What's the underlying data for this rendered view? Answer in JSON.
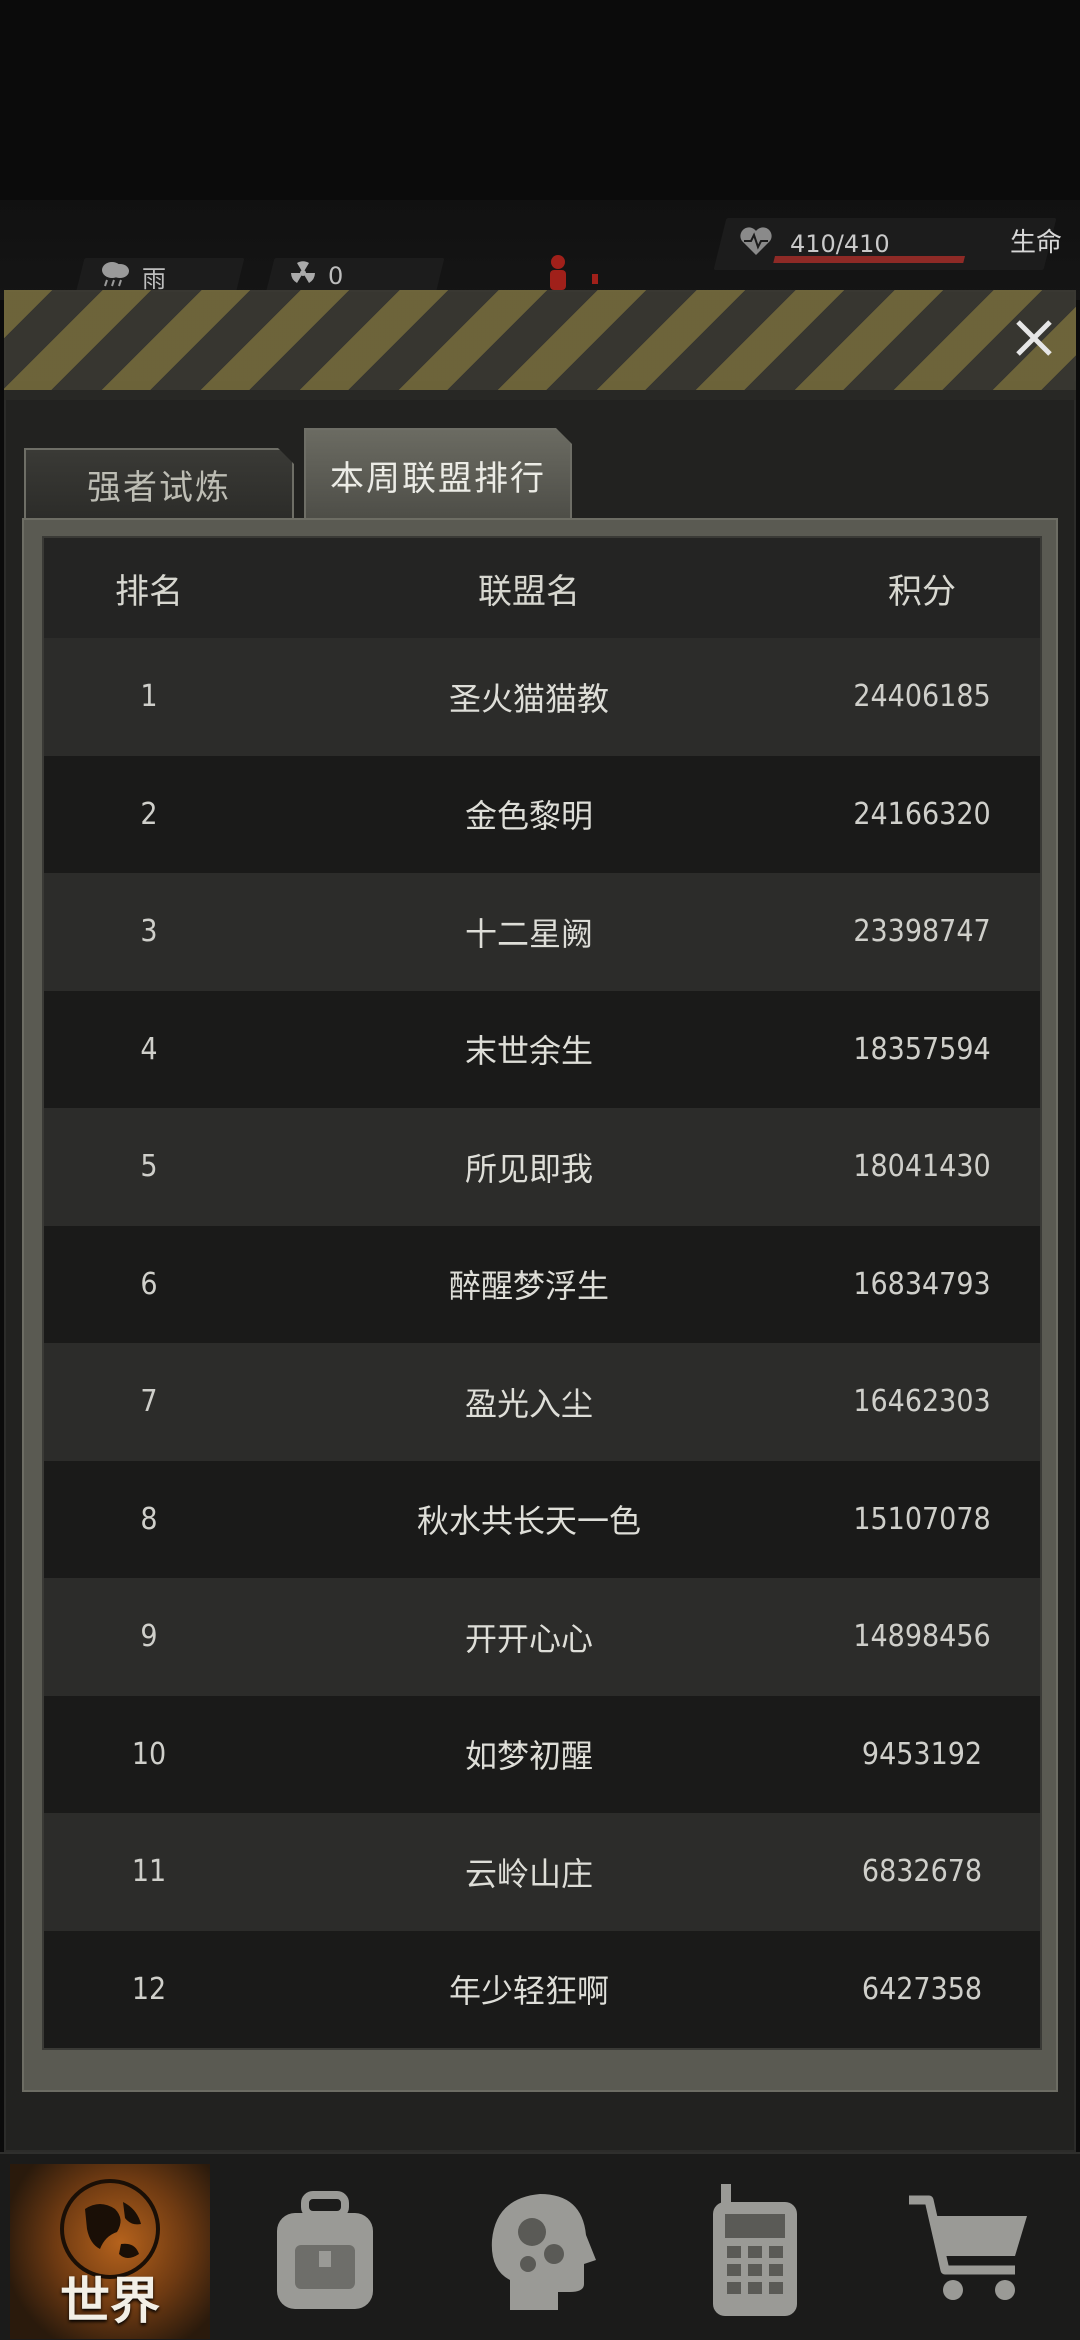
{
  "status": {
    "weather_label": "雨",
    "radiation_value": "0",
    "health_text": "410/410",
    "life_label": "生命",
    "health_fraction": 1.0
  },
  "tabs": [
    {
      "label": "强者试炼",
      "active": false
    },
    {
      "label": "本周联盟排行",
      "active": true
    }
  ],
  "table": {
    "headers": {
      "rank": "排名",
      "name": "联盟名",
      "score": "积分"
    },
    "rows": [
      {
        "rank": "1",
        "name": "圣火猫猫教",
        "score": "24406185"
      },
      {
        "rank": "2",
        "name": "金色黎明",
        "score": "24166320"
      },
      {
        "rank": "3",
        "name": "十二星阙",
        "score": "23398747"
      },
      {
        "rank": "4",
        "name": "末世余生",
        "score": "18357594"
      },
      {
        "rank": "5",
        "name": "所见即我",
        "score": "18041430"
      },
      {
        "rank": "6",
        "name": "醉醒梦浮生",
        "score": "16834793"
      },
      {
        "rank": "7",
        "name": "盈光入尘",
        "score": "16462303"
      },
      {
        "rank": "8",
        "name": "秋水共长天一色",
        "score": "15107078"
      },
      {
        "rank": "9",
        "name": "开开心心",
        "score": "14898456"
      },
      {
        "rank": "10",
        "name": "如梦初醒",
        "score": "9453192"
      },
      {
        "rank": "11",
        "name": "云岭山庄",
        "score": "6832678"
      },
      {
        "rank": "12",
        "name": "年少轻狂啊",
        "score": "6427358"
      }
    ]
  },
  "bottom_nav": {
    "world_label": "世界",
    "items": [
      "globe-icon",
      "backpack-icon",
      "brain-head-icon",
      "radio-device-icon",
      "shopping-cart-icon"
    ]
  },
  "colors": {
    "hazard_yellow": "#7a6f3e",
    "health_red": "#8e2a26",
    "world_orange": "#b5621c"
  }
}
